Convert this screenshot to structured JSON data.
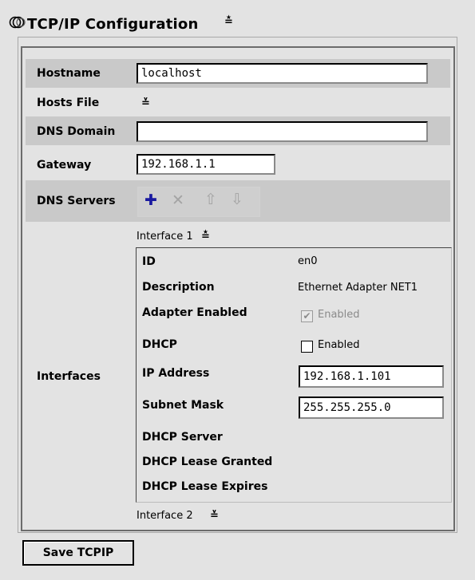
{
  "title": "TCP/IP Configuration",
  "title_caret": "≛",
  "hostname": {
    "label": "Hostname",
    "value": "localhost"
  },
  "hosts_file": {
    "label": "Hosts File",
    "toggle": "≚"
  },
  "dns_domain": {
    "label": "DNS Domain",
    "value": ""
  },
  "gateway": {
    "label": "Gateway",
    "value": "192.168.1.1"
  },
  "dns_servers": {
    "label": "DNS Servers",
    "tools": {
      "add": "✚",
      "remove": "✕",
      "up": "⇧",
      "down": "⇩"
    }
  },
  "interfaces": {
    "label": "Interfaces",
    "iface1": {
      "header": "Interface 1",
      "caret": "≛",
      "id_label": "ID",
      "id_value": "en0",
      "desc_label": "Description",
      "desc_value": "Ethernet Adapter NET1",
      "adapter_label": "Adapter Enabled",
      "adapter_value": "Enabled",
      "adapter_checked": true,
      "dhcp_label": "DHCP",
      "dhcp_value": "Enabled",
      "dhcp_checked": false,
      "ip_label": "IP Address",
      "ip_value": "192.168.1.101",
      "mask_label": "Subnet Mask",
      "mask_value": "255.255.255.0",
      "dhcp_server_label": "DHCP Server",
      "lease_granted_label": "DHCP Lease Granted",
      "lease_expires_label": "DHCP Lease Expires"
    },
    "iface2": {
      "header": "Interface 2",
      "caret": "≚"
    }
  },
  "save_label": "Save TCPIP",
  "icons": {
    "title": "network-rings-icon"
  }
}
